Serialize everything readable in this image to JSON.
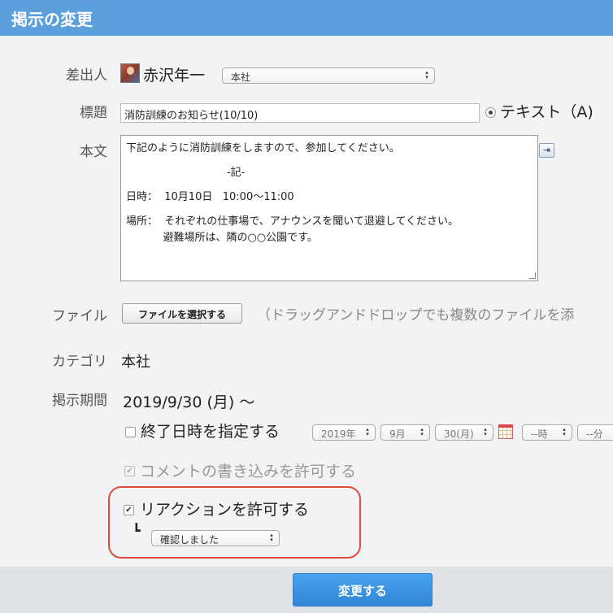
{
  "header": {
    "title": "掲示の変更"
  },
  "sender": {
    "label": "差出人",
    "name": "赤沢年一",
    "org_select": "本社",
    "avatar_icon": "user-avatar"
  },
  "subject": {
    "label": "標題",
    "value": "消防訓練のお知らせ(10/10)",
    "format_option": "テキスト（A)"
  },
  "body": {
    "label": "本文",
    "lines": [
      "下記のように消防訓練をしますので、参加してください。",
      "",
      "                              -記-",
      "",
      "日時：  10月10日   10:00～11:00",
      "",
      "場所：  それぞれの仕事場で、アナウンスを聞いて退避してください。",
      "           避難場所は、隣の○○公園です。"
    ]
  },
  "file": {
    "label": "ファイル",
    "button_label": "ファイルを選択する",
    "hint": "（ドラッグアンドドロップでも複数のファイルを添"
  },
  "category": {
    "label": "カテゴリ",
    "value": "本社"
  },
  "period": {
    "label": "掲示期間",
    "start": "2019/9/30 (月) ～",
    "end_checkbox_label": "終了日時を指定する",
    "year": "2019年",
    "month": "9月",
    "day": "30(月)",
    "hour": "--時",
    "minute": "--分"
  },
  "comment": {
    "label": "コメントの書き込みを許可する"
  },
  "reaction": {
    "label": "リアクションを許可する",
    "indent_mark": "┗",
    "option": "確認しました"
  },
  "footer": {
    "submit_label": "変更する"
  },
  "colors": {
    "header_bg": "#5b9fdc",
    "highlight": "#e04a3a",
    "submit_bg": "#2f86d6"
  }
}
